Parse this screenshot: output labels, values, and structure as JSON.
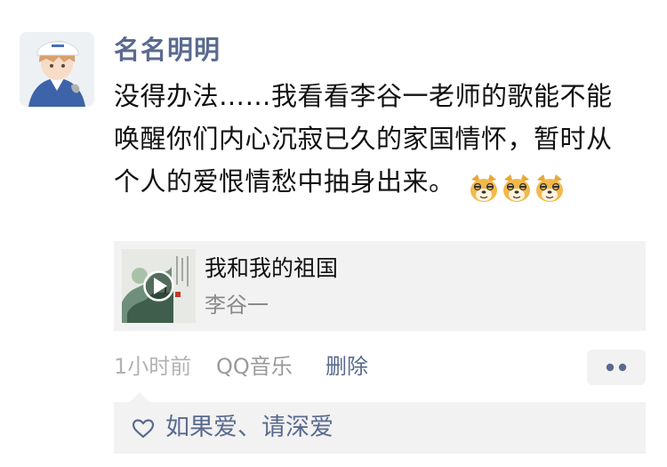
{
  "post": {
    "username": "名名明明",
    "text": "没得办法……我看看李谷一老师的歌能不能唤醒你们内心沉寂已久的家国情怀，暂时从个人的爱恨情愁中抽身出来。",
    "emoji_icons": [
      "dog-face-emoji",
      "dog-face-emoji",
      "dog-face-emoji"
    ]
  },
  "share": {
    "title": "我和我的祖国",
    "artist": "李谷一"
  },
  "meta": {
    "time": "1小时前",
    "source": "QQ音乐",
    "delete_label": "删除"
  },
  "likes": {
    "icon": "heart-outline-icon",
    "names": "如果爱、请深爱"
  },
  "colors": {
    "name_blue": "#5a6a8f",
    "card_bg": "#f2f2f2"
  }
}
